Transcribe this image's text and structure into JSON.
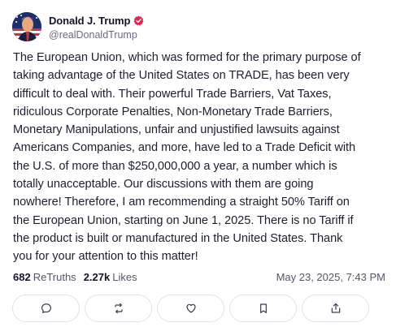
{
  "author": {
    "display_name": "Donald J. Trump",
    "handle": "@realDonaldTrump",
    "avatar_icon": "profile-avatar",
    "verified_color": "#e0284f"
  },
  "post": {
    "lines": [
      "The European Union, which was formed for the primary purpose of",
      "taking advantage of the United States on TRADE, has been very",
      "difficult to deal with. Their powerful Trade Barriers, Vat Taxes,",
      "ridiculous Corporate Penalties, Non-Monetary Trade Barriers,",
      "Monetary Manipulations, unfair and unjustified lawsuits against",
      "Americans Companies, and more, have led to a Trade Deficit with",
      "the U.S. of more than $250,000,000 a year, a number which is",
      "totally unacceptable. Our discussions with them are going",
      "nowhere! Therefore, I am recommending a straight 50% Tariff on",
      "the European Union, starting on June 1, 2025. There is no Tariff if",
      "the product is built or manufactured in the United States. Thank",
      "you for your attention to this matter!"
    ]
  },
  "stats": {
    "retruths_count": "682",
    "retruths_label": "ReTruths",
    "likes_count": "2.27k",
    "likes_label": "Likes",
    "timestamp": "May 23, 2025, 7:43 PM"
  },
  "actions": [
    {
      "icon": "reply-icon"
    },
    {
      "icon": "retruth-icon"
    },
    {
      "icon": "like-icon"
    },
    {
      "icon": "bookmark-icon"
    },
    {
      "icon": "share-icon"
    }
  ]
}
